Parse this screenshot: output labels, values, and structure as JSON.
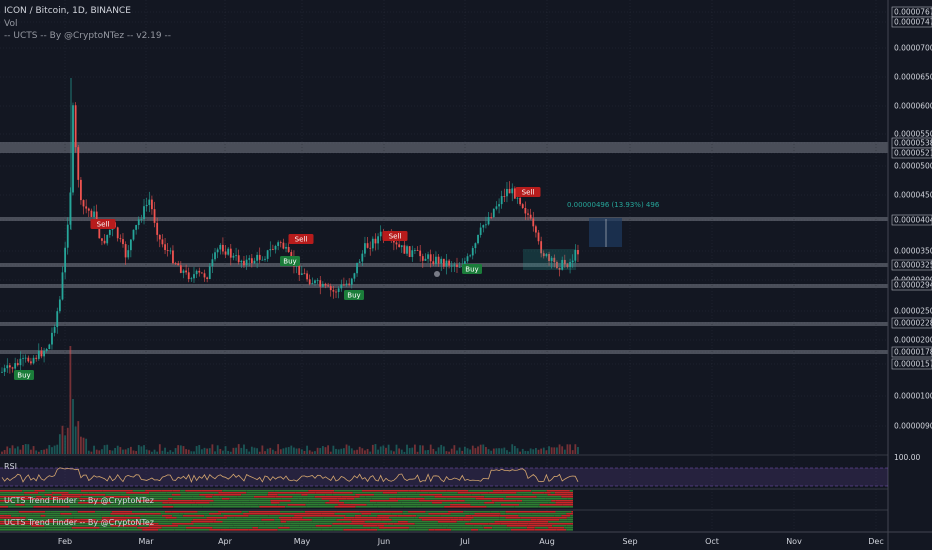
{
  "header": {
    "symbol_line": "ICON / Bitcoin, 1D, BINANCE",
    "vol_label": "Vol",
    "indicator_label": "-- UCTS -- By @CryptoNTez -- v2.19 --"
  },
  "price_axis": {
    "labels": [
      "0.00007670",
      "0.00007470",
      "0.00007000",
      "0.00006500",
      "0.00006000",
      "0.00005500",
      "0.00005380",
      "0.00005210",
      "0.00005000",
      "0.00004500",
      "0.00004040",
      "0.00003500",
      "0.00003257",
      "0.00003000",
      "0.00002940",
      "0.00002500",
      "0.00002280",
      "0.00002000",
      "0.00001788",
      "0.00001574",
      "0.00001000",
      "0.00000900"
    ],
    "boxed_labels": [
      "0.00007670",
      "0.00007470",
      "0.00005380",
      "0.00005210",
      "0.00004040",
      "0.00003257",
      "0.00002940",
      "0.00002280",
      "0.00001788",
      "0.00001574"
    ]
  },
  "time_axis": {
    "labels": [
      "Feb",
      "Mar",
      "Apr",
      "May",
      "Jun",
      "Jul",
      "Aug",
      "Sep",
      "Oct",
      "Nov",
      "Dec"
    ]
  },
  "signals": [
    {
      "label": "Buy",
      "kind": "buy"
    },
    {
      "label": "Sell",
      "kind": "sell"
    },
    {
      "label": "Sell",
      "kind": "sell"
    },
    {
      "label": "Buy",
      "kind": "buy"
    },
    {
      "label": "Buy",
      "kind": "buy"
    },
    {
      "label": "Sell",
      "kind": "sell"
    },
    {
      "label": "Buy",
      "kind": "buy"
    },
    {
      "label": "Sell",
      "kind": "sell"
    }
  ],
  "measure": {
    "text": "0.00000496 (13.93%) 496"
  },
  "rsi": {
    "title": "RSI",
    "level_label": "100.00"
  },
  "trend_panels": [
    {
      "title": "UCTS Trend Finder -- By @CryptoNTez"
    },
    {
      "title": "UCTS Trend Finder -- By @CryptoNTez"
    }
  ],
  "colors": {
    "background": "#131722",
    "up": "#26a69a",
    "down": "#ef5350",
    "zone": "#787b86",
    "rsi_fill": "#7e57c2",
    "buy": "#1b7d3a",
    "sell": "#b71c1c"
  }
}
